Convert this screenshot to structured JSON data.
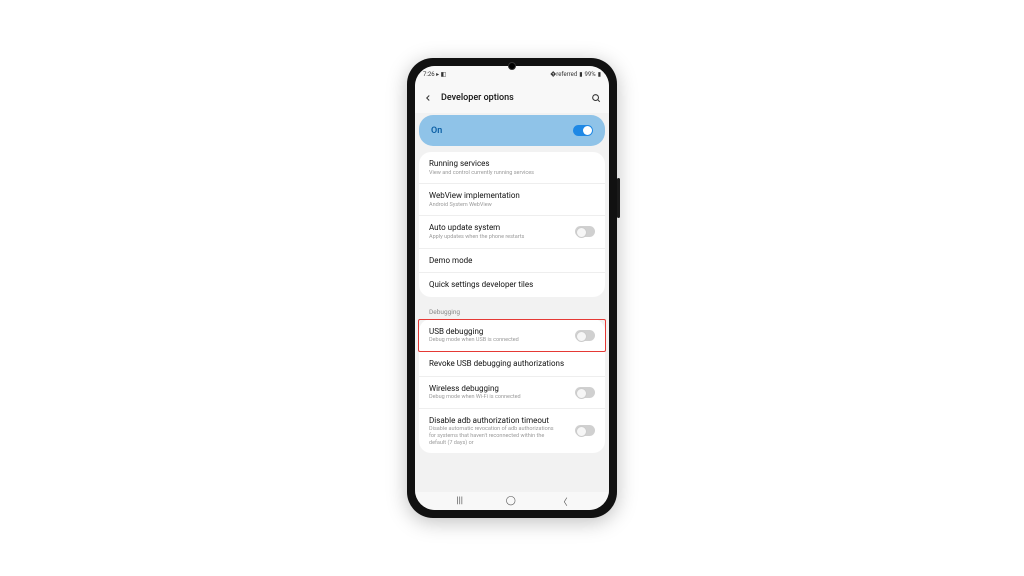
{
  "statusbar": {
    "time": "7:26",
    "icons_left": "▸ ◧",
    "battery": "99%"
  },
  "header": {
    "title": "Developer options"
  },
  "banner": {
    "label": "On"
  },
  "group1": [
    {
      "title": "Running services",
      "sub": "View and control currently running services",
      "toggle": null
    },
    {
      "title": "WebView implementation",
      "sub": "Android System WebView",
      "toggle": null
    },
    {
      "title": "Auto update system",
      "sub": "Apply updates when the phone restarts",
      "toggle": false
    },
    {
      "title": "Demo mode",
      "sub": "",
      "toggle": null
    },
    {
      "title": "Quick settings developer tiles",
      "sub": "",
      "toggle": null
    }
  ],
  "section_debugging": "Debugging",
  "group2": [
    {
      "title": "USB debugging",
      "sub": "Debug mode when USB is connected",
      "toggle": false,
      "highlight": true
    },
    {
      "title": "Revoke USB debugging authorizations",
      "sub": "",
      "toggle": null
    },
    {
      "title": "Wireless debugging",
      "sub": "Debug mode when Wi-Fi is connected",
      "toggle": false
    },
    {
      "title": "Disable adb authorization timeout",
      "sub": "Disable automatic revocation of adb authorizations for systems that haven't reconnected within the default (7 days) or",
      "toggle": false
    }
  ]
}
